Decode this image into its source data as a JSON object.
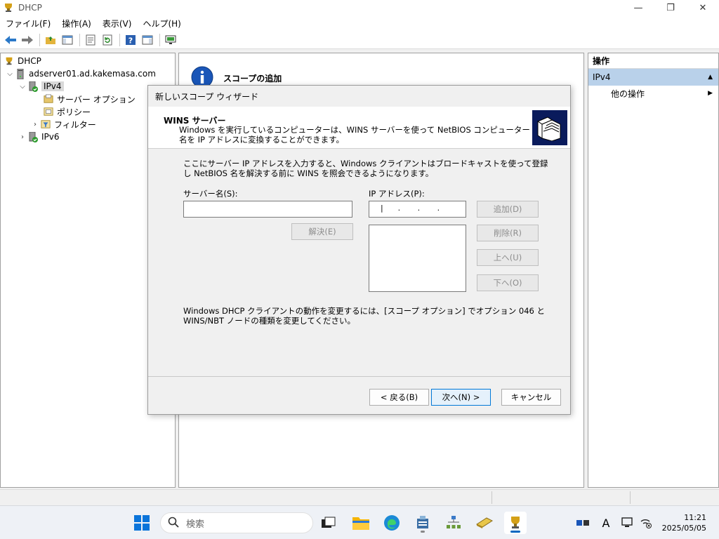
{
  "window": {
    "title": "DHCP",
    "controls": [
      "—",
      "❐",
      "✕"
    ]
  },
  "menu": [
    "ファイル(F)",
    "操作(A)",
    "表示(V)",
    "ヘルプ(H)"
  ],
  "tree": {
    "root": "DHCP",
    "server": "adserver01.ad.kakemasa.com",
    "ipv4": "IPv4",
    "server_options": "サーバー オプション",
    "policy": "ポリシー",
    "filter": "フィルター",
    "ipv6": "IPv6"
  },
  "center": {
    "header": "スコープの追加"
  },
  "actions": {
    "header": "操作",
    "section": "IPv4",
    "more": "他の操作"
  },
  "wizard": {
    "title": "新しいスコープ ウィザード",
    "header_title": "WINS サーバー",
    "header_desc": "Windows を実行しているコンピューターは、WINS サーバーを使って NetBIOS コンピューター名を IP アドレスに変換することができます。",
    "body_desc": "ここにサーバー IP アドレスを入力すると、Windows クライアントはブロードキャストを使って登録し NetBIOS 名を解決する前に WINS を照会できるようになります。",
    "server_name_label": "サーバー名(S):",
    "server_name_value": "",
    "ip_label": "IP アドレス(P):",
    "ip_value": "|      .       .       .",
    "resolve_button": "解決(E)",
    "add_button": "追加(D)",
    "remove_button": "削除(R)",
    "up_button": "上へ(U)",
    "down_button": "下へ(O)",
    "note": "Windows DHCP クライアントの動作を変更するには、[スコープ オプション] でオプション 046 と WINS/NBT ノードの種類を変更してください。",
    "back_button": "< 戻る(B)",
    "next_button": "次へ(N) >",
    "cancel_button": "キャンセル"
  },
  "taskbar": {
    "search_placeholder": "検索",
    "time": "11:21",
    "date": "2025/05/05",
    "ime": "A"
  }
}
